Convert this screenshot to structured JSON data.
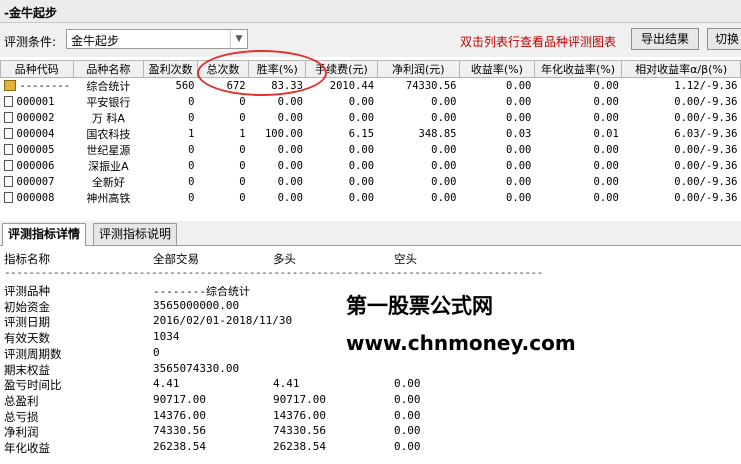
{
  "window": {
    "title": "-金牛起步"
  },
  "toolbar": {
    "criteria_label": "评测条件:",
    "criteria_value": "金牛起步",
    "hint": "双击列表行查看品种评测图表",
    "export_label": "导出结果",
    "switch_label": "切换"
  },
  "table": {
    "columns": [
      "品种代码",
      "品种名称",
      "盈利次数",
      "总次数",
      "胜率(%)",
      "手续费(元)",
      "净利润(元)",
      "收益率(%)",
      "年化收益率(%)",
      "相对收益率α/β(%)"
    ],
    "rows": [
      [
        "--------",
        "综合统计",
        "560",
        "672",
        "83.33",
        "2010.44",
        "74330.56",
        "0.00",
        "0.00",
        "1.12/-9.36"
      ],
      [
        "000001",
        "平安银行",
        "0",
        "0",
        "0.00",
        "0.00",
        "0.00",
        "0.00",
        "0.00",
        "0.00/-9.36"
      ],
      [
        "000002",
        "万 科A",
        "0",
        "0",
        "0.00",
        "0.00",
        "0.00",
        "0.00",
        "0.00",
        "0.00/-9.36"
      ],
      [
        "000004",
        "国农科技",
        "1",
        "1",
        "100.00",
        "6.15",
        "348.85",
        "0.03",
        "0.01",
        "6.03/-9.36"
      ],
      [
        "000005",
        "世纪星源",
        "0",
        "0",
        "0.00",
        "0.00",
        "0.00",
        "0.00",
        "0.00",
        "0.00/-9.36"
      ],
      [
        "000006",
        "深振业A",
        "0",
        "0",
        "0.00",
        "0.00",
        "0.00",
        "0.00",
        "0.00",
        "0.00/-9.36"
      ],
      [
        "000007",
        "全新好",
        "0",
        "0",
        "0.00",
        "0.00",
        "0.00",
        "0.00",
        "0.00",
        "0.00/-9.36"
      ],
      [
        "000008",
        "神州高铁",
        "0",
        "0",
        "0.00",
        "0.00",
        "0.00",
        "0.00",
        "0.00",
        "0.00/-9.36"
      ]
    ]
  },
  "tabs": [
    "评测指标详情",
    "评测指标说明"
  ],
  "detail": {
    "headers": [
      "指标名称",
      "全部交易",
      "多头",
      "空头"
    ],
    "separator": "----------------------------------------------------------------------------------------",
    "rows": [
      [
        "评测品种",
        "--------综合统计",
        "",
        ""
      ],
      [
        "初始资金",
        "3565000000.00",
        "",
        ""
      ],
      [
        "评测日期",
        "2016/02/01-2018/11/30",
        "",
        ""
      ],
      [
        "有效天数",
        "1034",
        "",
        ""
      ],
      [
        "评测周期数",
        "0",
        "",
        ""
      ],
      [
        "期末权益",
        "3565074330.00",
        "",
        ""
      ],
      [
        "盈亏时间比",
        "4.41",
        "4.41",
        "0.00"
      ],
      [
        "总盈利",
        "90717.00",
        "90717.00",
        "0.00"
      ],
      [
        "总亏损",
        "14376.00",
        "14376.00",
        "0.00"
      ],
      [
        "净利润",
        "74330.56",
        "74330.56",
        "0.00"
      ],
      [
        "年化收益",
        "26238.54",
        "26238.54",
        "0.00"
      ]
    ]
  },
  "watermark": {
    "line1": "第一股票公式网",
    "line2": "www.chnmoney.com"
  }
}
